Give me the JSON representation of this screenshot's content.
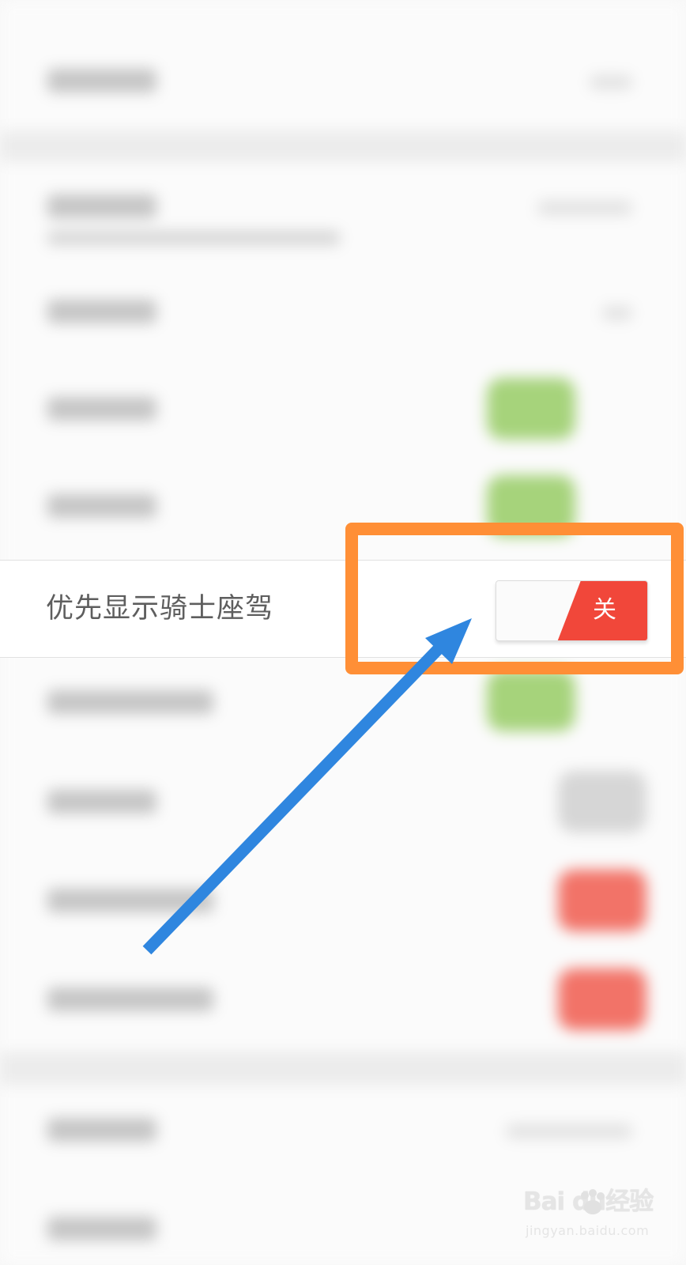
{
  "highlighted_setting": {
    "label": "优先显示骑士座驾",
    "toggle_state": "关"
  },
  "watermark": {
    "main": "Bai du经验",
    "sub": "jingyan.baidu.com"
  },
  "colors": {
    "toggle_off": "#f1473a",
    "highlight": "#ff8f36",
    "arrow": "#2f86df",
    "background": "#f7f7f7"
  },
  "icons": {
    "pointer_arrow": "arrow-icon",
    "watermark_logo": "baidu-paw-icon"
  }
}
